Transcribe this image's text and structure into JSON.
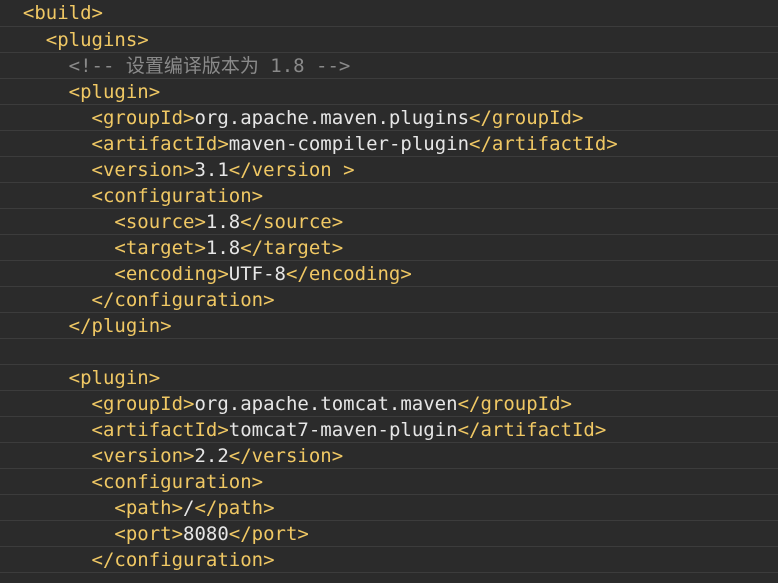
{
  "code": {
    "lines": [
      {
        "indent": "  ",
        "tokens": [
          {
            "type": "tag",
            "text": "<build>"
          }
        ]
      },
      {
        "indent": "    ",
        "tokens": [
          {
            "type": "tag",
            "text": "<plugins>"
          }
        ]
      },
      {
        "indent": "      ",
        "tokens": [
          {
            "type": "comment",
            "text": "<!-- 设置编译版本为 1.8 -->"
          }
        ]
      },
      {
        "indent": "      ",
        "tokens": [
          {
            "type": "tag",
            "text": "<plugin>"
          }
        ]
      },
      {
        "indent": "        ",
        "tokens": [
          {
            "type": "tag",
            "text": "<groupId>"
          },
          {
            "type": "text",
            "text": "org.apache.maven.plugins"
          },
          {
            "type": "tag",
            "text": "</groupId>"
          }
        ]
      },
      {
        "indent": "        ",
        "tokens": [
          {
            "type": "tag",
            "text": "<artifactId>"
          },
          {
            "type": "text",
            "text": "maven-compiler-plugin"
          },
          {
            "type": "tag",
            "text": "</artifactId>"
          }
        ]
      },
      {
        "indent": "        ",
        "tokens": [
          {
            "type": "tag",
            "text": "<version>"
          },
          {
            "type": "text",
            "text": "3.1"
          },
          {
            "type": "tag",
            "text": "</version >"
          }
        ]
      },
      {
        "indent": "        ",
        "tokens": [
          {
            "type": "tag",
            "text": "<configuration>"
          }
        ]
      },
      {
        "indent": "          ",
        "tokens": [
          {
            "type": "tag",
            "text": "<source>"
          },
          {
            "type": "text",
            "text": "1.8"
          },
          {
            "type": "tag",
            "text": "</source>"
          }
        ]
      },
      {
        "indent": "          ",
        "tokens": [
          {
            "type": "tag",
            "text": "<target>"
          },
          {
            "type": "text",
            "text": "1.8"
          },
          {
            "type": "tag",
            "text": "</target>"
          }
        ]
      },
      {
        "indent": "          ",
        "tokens": [
          {
            "type": "tag",
            "text": "<encoding>"
          },
          {
            "type": "text",
            "text": "UTF-8"
          },
          {
            "type": "tag",
            "text": "</encoding>"
          }
        ]
      },
      {
        "indent": "        ",
        "tokens": [
          {
            "type": "tag",
            "text": "</configuration>"
          }
        ]
      },
      {
        "indent": "      ",
        "tokens": [
          {
            "type": "tag",
            "text": "</plugin>"
          }
        ]
      },
      {
        "indent": "",
        "tokens": []
      },
      {
        "indent": "      ",
        "tokens": [
          {
            "type": "tag",
            "text": "<plugin>"
          }
        ]
      },
      {
        "indent": "        ",
        "tokens": [
          {
            "type": "tag",
            "text": "<groupId>"
          },
          {
            "type": "text",
            "text": "org.apache.tomcat.maven"
          },
          {
            "type": "tag",
            "text": "</groupId>"
          }
        ]
      },
      {
        "indent": "        ",
        "tokens": [
          {
            "type": "tag",
            "text": "<artifactId>"
          },
          {
            "type": "text",
            "text": "tomcat7-maven-plugin"
          },
          {
            "type": "tag",
            "text": "</artifactId>"
          }
        ]
      },
      {
        "indent": "        ",
        "tokens": [
          {
            "type": "tag",
            "text": "<version>"
          },
          {
            "type": "text",
            "text": "2.2"
          },
          {
            "type": "tag",
            "text": "</version>"
          }
        ]
      },
      {
        "indent": "        ",
        "tokens": [
          {
            "type": "tag",
            "text": "<configuration>"
          }
        ]
      },
      {
        "indent": "          ",
        "tokens": [
          {
            "type": "tag",
            "text": "<path>"
          },
          {
            "type": "text",
            "text": "/"
          },
          {
            "type": "tag",
            "text": "</path>"
          }
        ]
      },
      {
        "indent": "          ",
        "tokens": [
          {
            "type": "tag",
            "text": "<port>"
          },
          {
            "type": "text",
            "text": "8080"
          },
          {
            "type": "tag",
            "text": "</port>"
          }
        ]
      },
      {
        "indent": "        ",
        "tokens": [
          {
            "type": "tag",
            "text": "</configuration>"
          }
        ]
      }
    ]
  },
  "colors": {
    "background": "#2b2b2b",
    "tag": "#f0c864",
    "text": "#e6e6e6",
    "comment": "#8a8a8a",
    "line_separator": "#3c3c3c"
  }
}
